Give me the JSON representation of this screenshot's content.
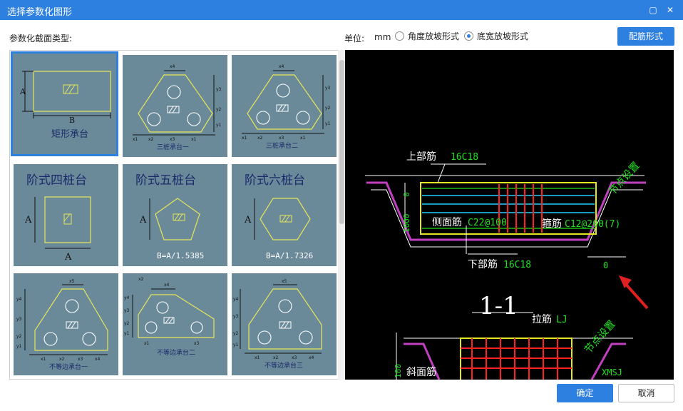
{
  "window": {
    "title": "选择参数化图形",
    "maximize_glyph": "▢",
    "close_glyph": "✕"
  },
  "toolbar": {
    "section_label": "参数化截面类型:",
    "unit_label": "单位:",
    "unit_value": "mm",
    "radio_angle": "角度放坡形式",
    "radio_width": "底宽放坡形式",
    "selected_radio": "radio_width",
    "rebar_button": "配筋形式"
  },
  "tiles": [
    {
      "name": "矩形承台",
      "labels": [
        "A",
        "B"
      ]
    },
    {
      "name": "三桩承台一",
      "labels": [
        "x4",
        "y3",
        "y2",
        "y1",
        "x1",
        "x2",
        "x3",
        "x1"
      ]
    },
    {
      "name": "三桩承台二",
      "labels": [
        "x4",
        "y3",
        "y2",
        "y1",
        "x1",
        "x2",
        "x3",
        "x1"
      ]
    },
    {
      "name": "阶式四桩台",
      "labels": [
        "A",
        "A"
      ]
    },
    {
      "name": "阶式五桩台",
      "labels": [
        "A",
        "B=A/1.5385"
      ]
    },
    {
      "name": "阶式六桩台",
      "labels": [
        "A",
        "B=A/1.7326"
      ]
    },
    {
      "name": "不等边承台一",
      "labels": [
        "x5",
        "y4",
        "y3",
        "y2",
        "y1",
        "x1",
        "x2",
        "x3",
        "x4"
      ]
    },
    {
      "name": "不等边承台二",
      "labels": [
        "x4",
        "x2",
        "y4",
        "y3",
        "y2",
        "y1",
        "x1",
        "x3"
      ]
    },
    {
      "name": "不等边承台三",
      "labels": [
        "x5",
        "y4",
        "y3",
        "y2",
        "y1",
        "x1",
        "x2",
        "x3",
        "x4"
      ]
    }
  ],
  "preview": {
    "top_bar": "上部筋",
    "top_bar_val": "16C18",
    "side_bar": "侧面筋",
    "side_bar_val": "C22@100",
    "stirrup": "箍筋",
    "stirrup_val": "C12@200(7)",
    "bottom_bar": "下部筋",
    "bottom_bar_val": "16C18",
    "node_setting": "节点设置",
    "dim_zero_left": "0",
    "dim_1000": "1000",
    "dim_zero_right": "0",
    "section": "1-1",
    "tie_bar": "拉筋",
    "tie_bar_val": "LJ",
    "node_setting_2": "节点设置",
    "diag_bar": "斜面筋",
    "dim_100": "100",
    "xmsj": "XMSJ"
  },
  "footer": {
    "ok": "确定",
    "cancel": "取消"
  },
  "colors": {
    "accent": "#2d7fe0",
    "tile_bg": "#6a8a9a",
    "preview_bg": "#000000",
    "shape_stroke": "#e6e65a",
    "arrow": "#e02020"
  }
}
